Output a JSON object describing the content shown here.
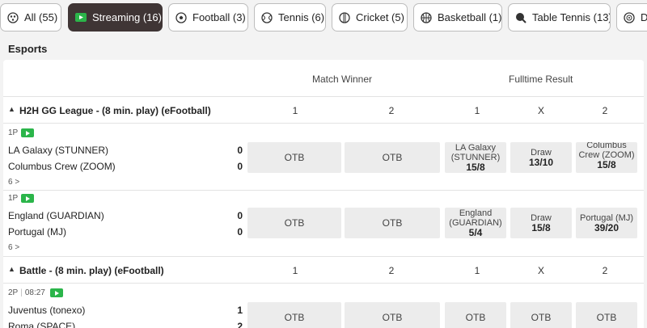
{
  "tabs": [
    {
      "label": "All (55)",
      "icon": "all-sports-icon"
    },
    {
      "label": "Streaming (16)",
      "icon": "streaming-icon",
      "active": true
    },
    {
      "label": "Football (3)",
      "icon": "football-icon"
    },
    {
      "label": "Tennis (6)",
      "icon": "tennis-icon"
    },
    {
      "label": "Cricket (5)",
      "icon": "cricket-icon"
    },
    {
      "label": "Basketball (1)",
      "icon": "basketball-icon"
    },
    {
      "label": "Table Tennis (13)",
      "icon": "table-tennis-icon"
    },
    {
      "label": "D",
      "icon": "darts-icon"
    }
  ],
  "section_title": "Esports",
  "market_headers": {
    "match_winner": "Match Winner",
    "fulltime_result": "Fulltime Result"
  },
  "groups": [
    {
      "title": "H2H GG League - (8 min. play) (eFootball)",
      "cols": [
        "1",
        "2",
        "1",
        "X",
        "2"
      ],
      "events": [
        {
          "period": "1P",
          "time": "",
          "home": "LA Galaxy (STUNNER)",
          "away": "Columbus Crew (ZOOM)",
          "home_score": "0",
          "away_score": "0",
          "more": "6 >",
          "mw1": "OTB",
          "mw2": "OTB",
          "ft": [
            {
              "name": "LA Galaxy (STUNNER)",
              "odds": "15/8"
            },
            {
              "name": "Draw",
              "odds": "13/10"
            },
            {
              "name": "Columbus Crew (ZOOM)",
              "odds": "15/8"
            }
          ]
        },
        {
          "period": "1P",
          "time": "",
          "home": "England (GUARDIAN)",
          "away": "Portugal (MJ)",
          "home_score": "0",
          "away_score": "0",
          "more": "6 >",
          "mw1": "OTB",
          "mw2": "OTB",
          "ft": [
            {
              "name": "England (GUARDIAN)",
              "odds": "5/4"
            },
            {
              "name": "Draw",
              "odds": "15/8"
            },
            {
              "name": "Portugal (MJ)",
              "odds": "39/20"
            }
          ]
        }
      ]
    },
    {
      "title": "Battle - (8 min. play) (eFootball)",
      "cols": [
        "1",
        "2",
        "1",
        "X",
        "2"
      ],
      "events": [
        {
          "period": "2P",
          "time": "08:27",
          "home": "Juventus (tonexo)",
          "away": "Roma (SPACE)",
          "home_score": "1",
          "away_score": "2",
          "mw1": "OTB",
          "mw2": "OTB",
          "ft_otb": [
            "OTB",
            "OTB",
            "OTB"
          ]
        }
      ]
    }
  ]
}
